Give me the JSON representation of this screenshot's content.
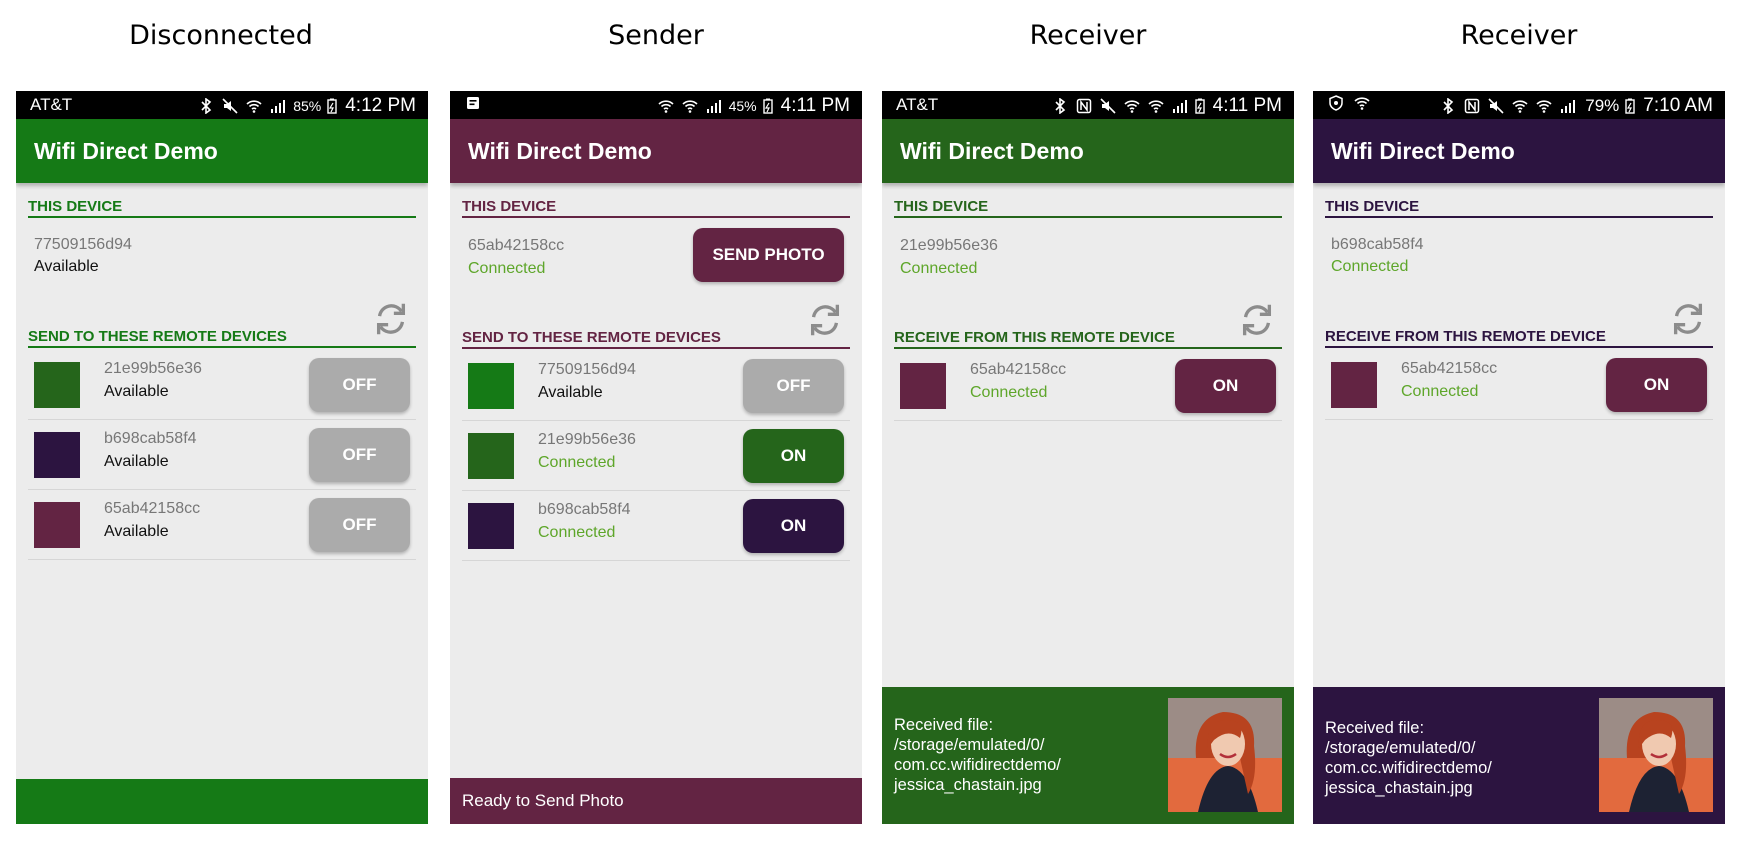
{
  "captions": [
    "Disconnected",
    "Sender",
    "Receiver",
    "Receiver"
  ],
  "app_title": "Wifi Direct Demo",
  "colors": {
    "green_primary": "#157a16",
    "green_dark": "#25651b",
    "maroon": "#632443",
    "purple": "#2c1440",
    "connected_text": "#5ea62a",
    "off_button": "#ababab"
  },
  "icons": [
    "bluetooth-icon",
    "mute-icon",
    "wifi-icon",
    "signal-icon",
    "battery-icon",
    "nfc-icon",
    "notification-icon",
    "shield-icon",
    "refresh-icon"
  ],
  "phones": [
    {
      "carrier": "AT&T",
      "battery": "85%",
      "time": "4:12 PM",
      "this_device_label": "THIS DEVICE",
      "device_id": "77509156d94",
      "device_status": "Available",
      "remote_label": "SEND TO THESE REMOTE DEVICES",
      "rows": [
        {
          "id": "21e99b56e36",
          "status": "Available",
          "toggle": "OFF"
        },
        {
          "id": "b698cab58f4",
          "status": "Available",
          "toggle": "OFF"
        },
        {
          "id": "65ab42158cc",
          "status": "Available",
          "toggle": "OFF"
        }
      ]
    },
    {
      "battery": "45%",
      "time": "4:11 PM",
      "this_device_label": "THIS DEVICE",
      "device_id": "65ab42158cc",
      "device_status": "Connected",
      "send_button": "SEND PHOTO",
      "remote_label": "SEND TO THESE REMOTE DEVICES",
      "rows": [
        {
          "id": "77509156d94",
          "status": "Available",
          "toggle": "OFF"
        },
        {
          "id": "21e99b56e36",
          "status": "Connected",
          "toggle": "ON"
        },
        {
          "id": "b698cab58f4",
          "status": "Connected",
          "toggle": "ON"
        }
      ],
      "footer": "Ready to Send Photo"
    },
    {
      "carrier": "AT&T",
      "time": "4:11 PM",
      "this_device_label": "THIS DEVICE",
      "device_id": "21e99b56e36",
      "device_status": "Connected",
      "remote_label": "RECEIVE FROM THIS REMOTE DEVICE",
      "rows": [
        {
          "id": "65ab42158cc",
          "status": "Connected",
          "toggle": "ON"
        }
      ],
      "received": [
        "Received file:",
        "/storage/emulated/0/",
        "com.cc.wifidirectdemo/",
        "jessica_chastain.jpg"
      ]
    },
    {
      "battery": "79%",
      "time": "7:10 AM",
      "this_device_label": "THIS DEVICE",
      "device_id": "b698cab58f4",
      "device_status": "Connected",
      "remote_label": "RECEIVE FROM THIS REMOTE DEVICE",
      "rows": [
        {
          "id": "65ab42158cc",
          "status": "Connected",
          "toggle": "ON"
        }
      ],
      "received": [
        "Received file:",
        "/storage/emulated/0/",
        "com.cc.wifidirectdemo/",
        "jessica_chastain.jpg"
      ]
    }
  ]
}
